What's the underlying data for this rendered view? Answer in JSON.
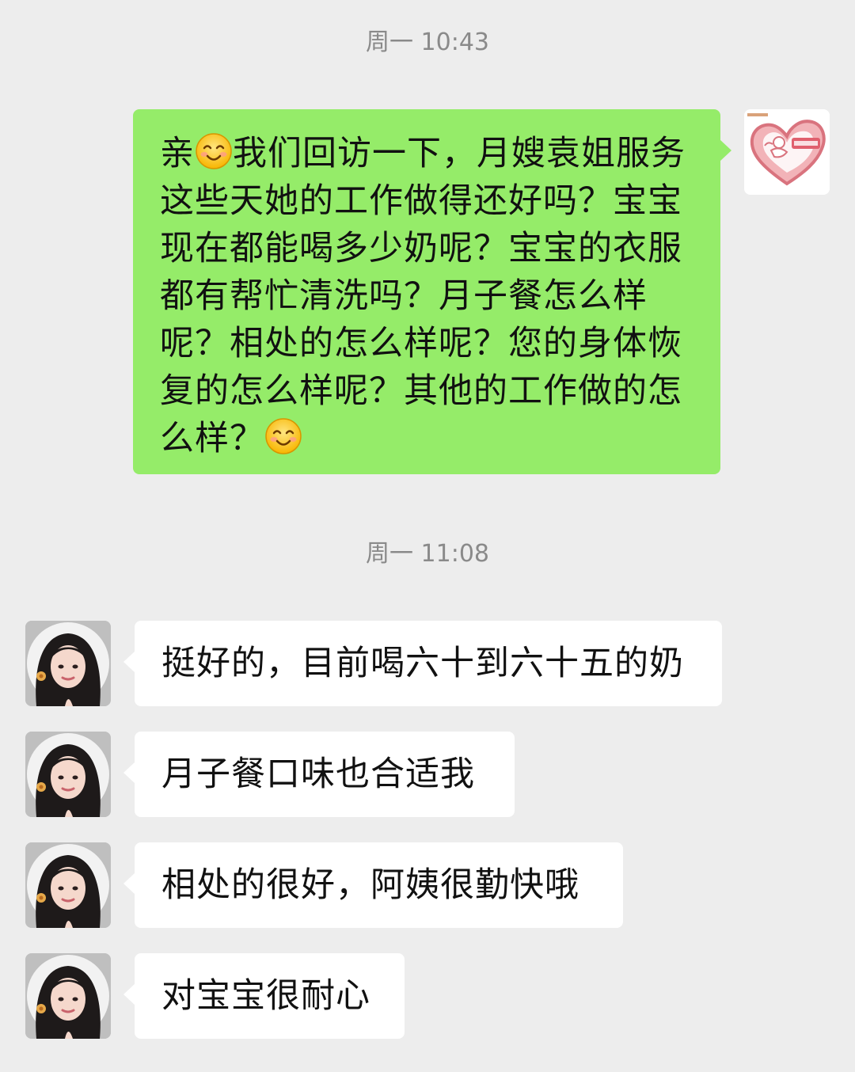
{
  "chat": {
    "messages": [
      {
        "timestamp": "周一 10:43",
        "direction": "outgoing",
        "segments": [
          {
            "type": "text",
            "value": "亲"
          },
          {
            "type": "emoji",
            "icon": "smile-emoji"
          },
          {
            "type": "text",
            "value": "我们回访一下，月嫂袁姐服务这些天她的工作做得还好吗？宝宝现在都能喝多少奶呢？宝宝的衣服都有帮忙清洗吗？月子餐怎么样呢？相处的怎么样呢？您的身体恢复的怎么样呢？其他的工作做的怎么样？"
          },
          {
            "type": "emoji",
            "icon": "smile-emoji"
          }
        ]
      }
    ],
    "incoming_timestamp": "周一 11:08",
    "incoming": [
      "挺好的，目前喝六十到六十五的奶",
      "月子餐口味也合适我",
      "相处的很好，阿姨很勤快哦",
      "对宝宝很耐心"
    ],
    "self_avatar": {
      "icon": "heart-cupid-logo"
    },
    "peer_avatar": {
      "icon": "woman-portrait-avatar"
    }
  },
  "colors": {
    "background": "#ededed",
    "outgoing_bubble": "#95ec69",
    "incoming_bubble": "#ffffff",
    "timestamp_text": "#8a8a8a"
  }
}
